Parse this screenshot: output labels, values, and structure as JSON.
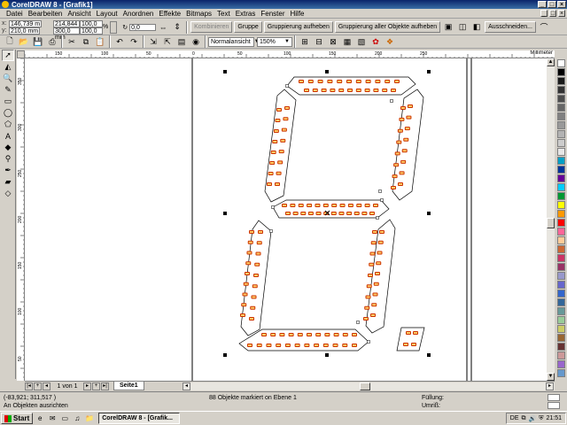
{
  "window": {
    "title": "CorelDRAW 8 - [Grafik1]",
    "controls": [
      "_",
      "□",
      "×"
    ]
  },
  "menu": [
    "Datei",
    "Bearbeiten",
    "Ansicht",
    "Layout",
    "Anordnen",
    "Effekte",
    "Bitmaps",
    "Text",
    "Extras",
    "Fenster",
    "Hilfe"
  ],
  "menu_doc_controls": [
    "_",
    "□",
    "×"
  ],
  "property_bar": {
    "x_label": "x:",
    "x_value": "146,739 m",
    "y_label": "y:",
    "y_value": "210,0 mm",
    "width_value": "214,844 m",
    "height_value": "300,0 mm",
    "scale_x": "100,0",
    "scale_y": "100,0",
    "scale_unit": "%",
    "rotation": "0,0",
    "combine_label": "Kombinieren",
    "group_label": "Gruppe",
    "ungroup_label": "Gruppierung aufheben",
    "ungroup_all_label": "Gruppierung aller Objekte aufheben",
    "trim_label": "Ausschneiden..."
  },
  "standard_bar": {
    "view_mode": "Normalansicht",
    "zoom": "150%"
  },
  "ruler": {
    "unit": "Millimeter",
    "h_ticks": [
      "150",
      "100",
      "50",
      "0",
      "50",
      "100",
      "150",
      "200",
      "250"
    ],
    "v_ticks": [
      "350",
      "300",
      "250",
      "200",
      "150",
      "100",
      "50"
    ]
  },
  "page_nav": {
    "page_info": "1 von 1",
    "page_tab": "Seite1"
  },
  "status": {
    "coords": "(-83,921; 311,517 )",
    "hint": "An Objekten ausrichten",
    "selection": "88 Objekte markiert on Ebene 1",
    "fill_label": "Füllung:",
    "outline_label": "Umriß:"
  },
  "taskbar": {
    "start_label": "Start",
    "task_label": "CorelDRAW 8 - [Grafik...",
    "clock": "21:51",
    "tray_lang": "DE"
  },
  "palette_colors": [
    "#ffffff",
    "#000000",
    "#1a1a1a",
    "#333333",
    "#4d4d4d",
    "#666666",
    "#808080",
    "#999999",
    "#b3b3b3",
    "#cccccc",
    "#e6e6e6",
    "#00a0c6",
    "#003399",
    "#660099",
    "#00ccff",
    "#009933",
    "#ffff00",
    "#ff9900",
    "#ff0000",
    "#ff6699",
    "#ffcc99",
    "#cc6633",
    "#cc3366",
    "#993366",
    "#9999cc",
    "#6666cc",
    "#3366cc",
    "#336699",
    "#669999",
    "#99cc99",
    "#cccc66",
    "#996633",
    "#663333",
    "#cc9999",
    "#9966cc",
    "#6699cc"
  ]
}
